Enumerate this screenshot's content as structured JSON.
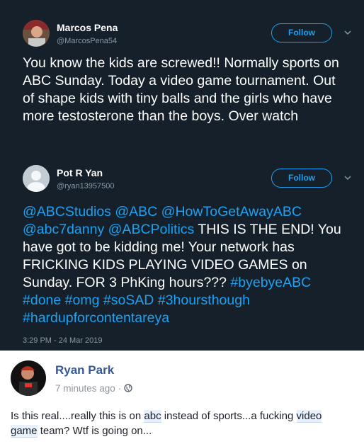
{
  "tweet1": {
    "name": "Marcos Pena",
    "handle": "@MarcosPena54",
    "follow_label": "Follow",
    "text": "You know the kids are screwed!! Normally sports on ABC Sunday. Today a video game tournament. Out of shape kids with tiny balls and the girls who have more testosterone than the boys. Over watch"
  },
  "tweet2": {
    "name": "Pot R Yan",
    "handle": "@ryan13957500",
    "follow_label": "Follow",
    "m1": "@ABCStudios",
    "m2": "@ABC",
    "m3": "@HowToGetAwayABC",
    "m4": "@abc7danny",
    "m5": "@ABCPolitics",
    "t1": " THIS IS THE END! You have got to be kidding me!  Your network has FRICKING KIDS PLAYING VIDEO GAMES on Sunday.  FOR 3 PhKing hours??? ",
    "h1": "#byebyeABC",
    "h2": "#done",
    "h3": "#omg",
    "h4": "#soSAD",
    "h5": "#3hoursthough",
    "h6": "#hardupforcontentareya",
    "timestamp": "3:29 PM - 24 Mar 2019"
  },
  "facebook": {
    "name": "Ryan Park",
    "time": "7 minutes ago",
    "sep": " · ",
    "p1": "Is this real....really this is on ",
    "hl1": "abc",
    "p2": " instead of sports...a fucking ",
    "hl2": "video game",
    "p3": " team? Wtf is going on..."
  },
  "colors": {
    "twitter_bg": "#15202b",
    "twitter_blue": "#1da1f2",
    "fb_blue": "#365899"
  }
}
